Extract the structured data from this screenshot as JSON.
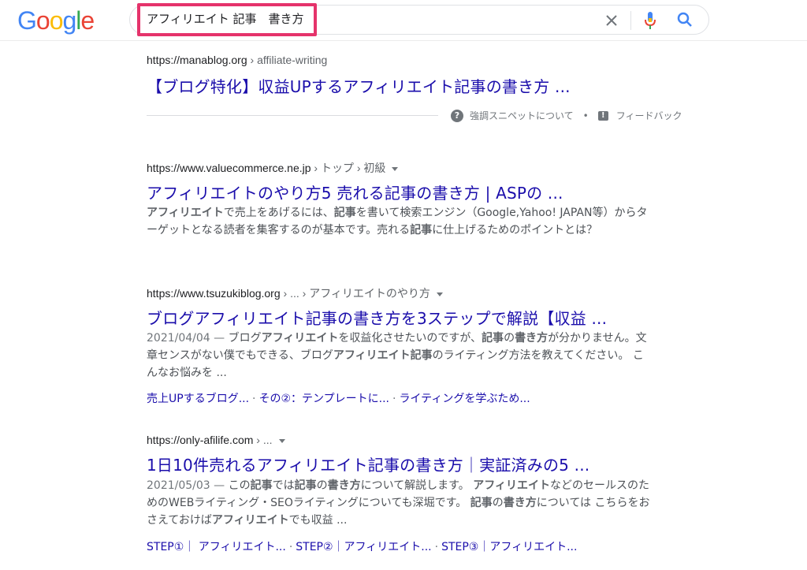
{
  "logo": "Google",
  "search": {
    "query": "アフィリエイト 記事　書き方"
  },
  "featured": {
    "url": "https://manablog.org",
    "crumb": " › affiliate-writing",
    "title": "【ブログ特化】収益UPするアフィリエイト記事の書き方 ...",
    "about_label": "強調スニペットについて",
    "bullet": "•",
    "feedback_label": "フィードバック"
  },
  "results": [
    {
      "url": "https://www.valuecommerce.ne.jp",
      "crumb": " › トップ › 初級",
      "title": "アフィリエイトのやり方5 売れる記事の書き方 | ASPの ...",
      "snippet": [
        {
          "t": "アフィリエイト",
          "b": true
        },
        {
          "t": "で売上をあげるには、",
          "b": false
        },
        {
          "t": "記事",
          "b": true
        },
        {
          "t": "を書いて検索エンジン（Google,Yahoo! JAPAN等）からターゲットとなる読者を集客するのが基本です。売れる",
          "b": false
        },
        {
          "t": "記事",
          "b": true
        },
        {
          "t": "に仕上げるためのポイントとは？",
          "b": false
        }
      ]
    },
    {
      "url": "https://www.tsuzukiblog.org",
      "crumb": " › ... › アフィリエイトのやり方",
      "title": "ブログアフィリエイト記事の書き方を3ステップで解説【収益 ...",
      "date": "2021/04/04 — ",
      "snippet": [
        {
          "t": "ブログ",
          "b": false
        },
        {
          "t": "アフィリエイト",
          "b": true
        },
        {
          "t": "を収益化させたいのですが、",
          "b": false
        },
        {
          "t": "記事",
          "b": true
        },
        {
          "t": "の",
          "b": false
        },
        {
          "t": "書き方",
          "b": true
        },
        {
          "t": "が分かりません。文章センスがない僕でもできる、ブログ",
          "b": false
        },
        {
          "t": "アフィリエイト記事",
          "b": true
        },
        {
          "t": "のライティング方法を教えてください。 こんなお悩みを ...",
          "b": false
        }
      ],
      "sitelinks": [
        "売上UPするブログ...",
        "その②：テンプレートに...",
        "ライティングを学ぶため..."
      ]
    },
    {
      "url": "https://only-afilife.com",
      "crumb": " › ...",
      "title": "1日10件売れるアフィリエイト記事の書き方｜実証済みの5 ...",
      "date": "2021/05/03 — ",
      "snippet": [
        {
          "t": "この",
          "b": false
        },
        {
          "t": "記事",
          "b": true
        },
        {
          "t": "では",
          "b": false
        },
        {
          "t": "記事",
          "b": true
        },
        {
          "t": "の",
          "b": false
        },
        {
          "t": "書き方",
          "b": true
        },
        {
          "t": "について解説します。 ",
          "b": false
        },
        {
          "t": "アフィリエイト",
          "b": true
        },
        {
          "t": "などのセールスのためのWEBライティング・SEOライティングについても深堀です。 ",
          "b": false
        },
        {
          "t": "記事",
          "b": true
        },
        {
          "t": "の",
          "b": false
        },
        {
          "t": "書き方",
          "b": true
        },
        {
          "t": "については こちらをおさえておけば",
          "b": false
        },
        {
          "t": "アフィリエイト",
          "b": true
        },
        {
          "t": "でも収益 ...",
          "b": false
        }
      ],
      "sitelinks": [
        "STEP①｜ アフィリエイト...",
        "STEP②｜アフィリエイト...",
        "STEP③｜アフィリエイト..."
      ]
    }
  ],
  "colors": {
    "link": "#1a0dab",
    "highlight": "#e5336b",
    "text": "#202124",
    "snippet": "#4d5156"
  },
  "icons": [
    "clear-icon",
    "mic-icon",
    "search-icon",
    "help-icon",
    "feedback-icon",
    "chevron-down-icon"
  ]
}
